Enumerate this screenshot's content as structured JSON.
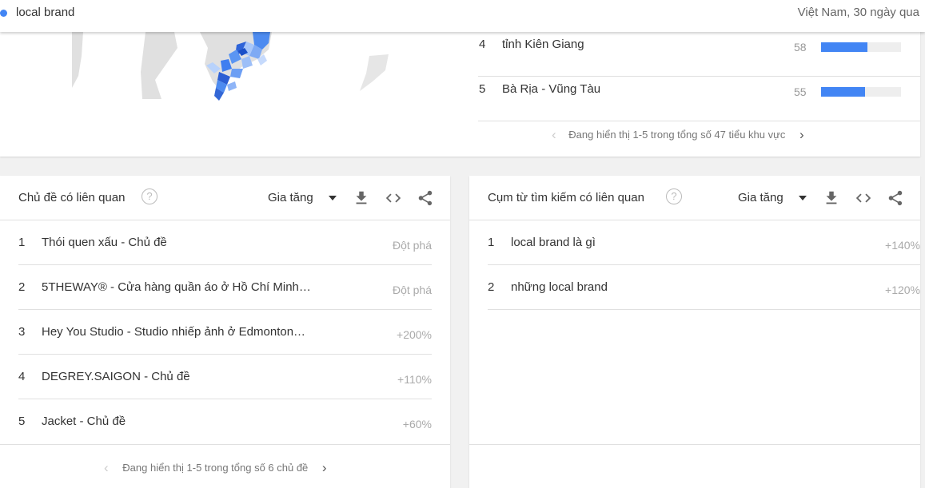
{
  "header": {
    "search_term": "local brand",
    "scope": "Việt Nam, 30 ngày qua"
  },
  "regions": {
    "rows": [
      {
        "rank": "4",
        "name": "tỉnh Kiên Giang",
        "score": "58",
        "fraction": 0.58
      },
      {
        "rank": "5",
        "name": "Bà Rịa - Vũng Tàu",
        "score": "55",
        "fraction": 0.55
      }
    ],
    "pager_text": "Đang hiển thị 1-5 trong tổng số 47 tiểu khu vực"
  },
  "topics": {
    "title": "Chủ đề có liên quan",
    "filter": "Gia tăng",
    "rows": [
      {
        "rank": "1",
        "label": "Thói quen xấu - Chủ đề",
        "value": "Đột phá"
      },
      {
        "rank": "2",
        "label": "5THEWAY® - Cửa hàng quần áo ở Hồ Chí Minh…",
        "value": "Đột phá"
      },
      {
        "rank": "3",
        "label": "Hey You Studio - Studio nhiếp ảnh ở Edmonton…",
        "value": "+200%"
      },
      {
        "rank": "4",
        "label": "DEGREY.SAIGON - Chủ đề",
        "value": "+110%"
      },
      {
        "rank": "5",
        "label": "Jacket - Chủ đề",
        "value": "+60%"
      }
    ],
    "pager_text": "Đang hiển thị 1-5 trong tổng số 6 chủ đề"
  },
  "queries": {
    "title": "Cụm từ tìm kiếm có liên quan",
    "filter": "Gia tăng",
    "rows": [
      {
        "rank": "1",
        "label": "local brand là gì",
        "value": "+140%"
      },
      {
        "rank": "2",
        "label": "những local brand",
        "value": "+120%"
      }
    ]
  },
  "colors": {
    "accent": "#4285f4",
    "map_dark": "#3367d6",
    "map_light": "#a8c7fa",
    "land": "#e0e0e0"
  },
  "icons": {
    "help": "help-circle-icon",
    "download": "download-icon",
    "embed": "code-icon",
    "share": "share-icon",
    "prev": "chevron-left-icon",
    "next": "chevron-right-icon"
  }
}
